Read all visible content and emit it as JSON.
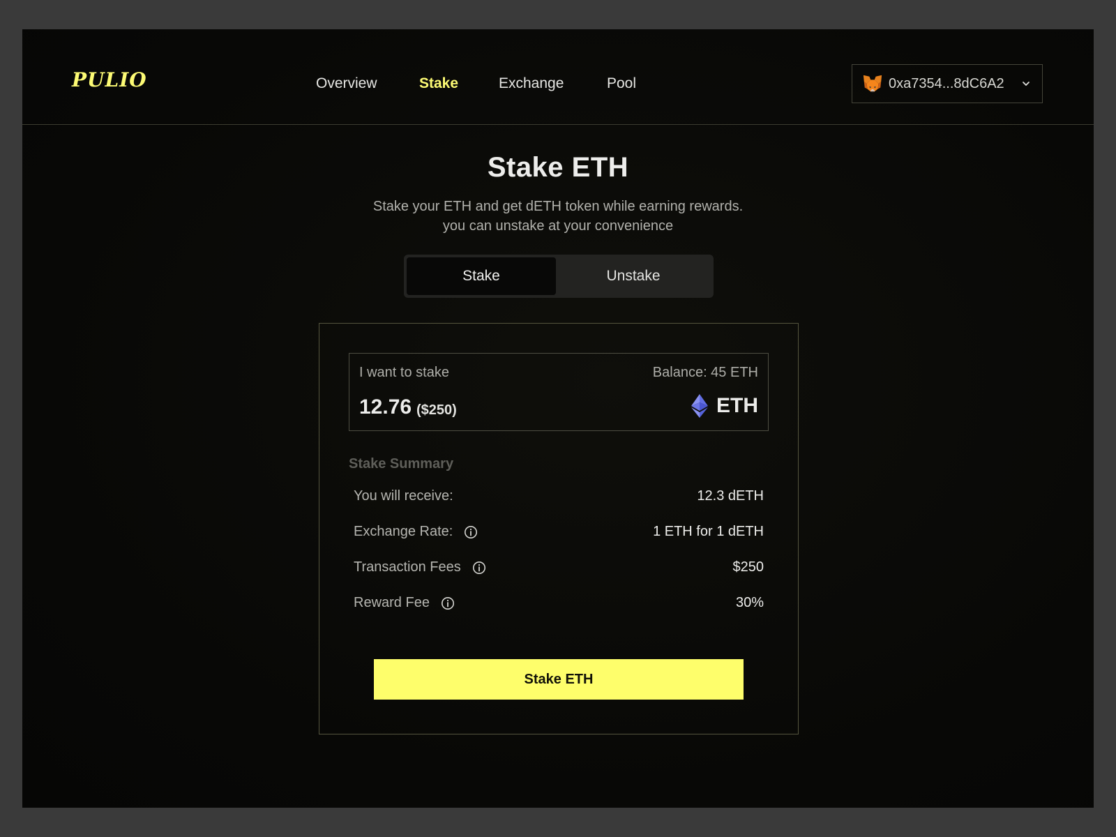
{
  "brand": {
    "logo": "PULIO",
    "accent_color": "#fdfb74"
  },
  "nav": {
    "items": [
      {
        "label": "Overview",
        "active": false
      },
      {
        "label": "Stake",
        "active": true
      },
      {
        "label": "Exchange",
        "active": false
      },
      {
        "label": "Pool",
        "active": false
      }
    ]
  },
  "wallet": {
    "address": "0xa7354...8dC6A2",
    "icon": "metamask-fox-icon",
    "dropdown_icon": "chevron-down-icon"
  },
  "hero": {
    "title": "Stake ETH",
    "subtitle_line1": "Stake your ETH and get dETH token while earning rewards.",
    "subtitle_line2": "you can unstake at your convenience"
  },
  "toggle": {
    "options": [
      "Stake",
      "Unstake"
    ],
    "selected": "Stake"
  },
  "stake_form": {
    "input_label": "I want to stake",
    "balance": "Balance: 45 ETH",
    "amount": "12.76",
    "amount_usd": "($250)",
    "token": "ETH",
    "token_icon": "ethereum-icon"
  },
  "summary": {
    "title": "Stake Summary",
    "rows": [
      {
        "label": "You will receive:",
        "value": "12.3 dETH",
        "info": false
      },
      {
        "label": "Exchange Rate:",
        "value": "1 ETH for 1 dETH",
        "info": true
      },
      {
        "label": "Transaction Fees",
        "value": "$250",
        "info": true
      },
      {
        "label": "Reward Fee",
        "value": "30%",
        "info": true
      }
    ]
  },
  "cta": {
    "label": "Stake ETH",
    "color": "#fefe6b"
  }
}
